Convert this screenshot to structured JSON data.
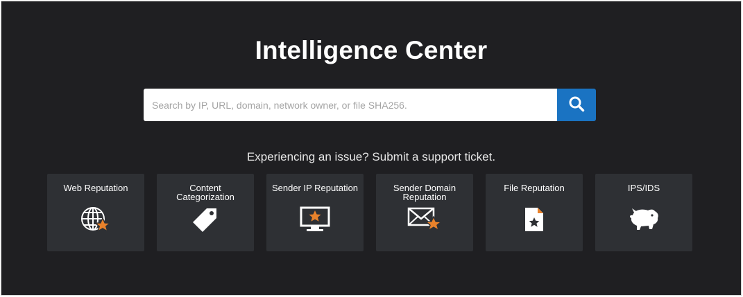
{
  "header": {
    "title": "Intelligence Center"
  },
  "search": {
    "placeholder": "Search by IP, URL, domain, network owner, or file SHA256."
  },
  "support": {
    "text": "Experiencing an issue? Submit a support ticket."
  },
  "tiles": [
    {
      "label": "Web Reputation",
      "icon": "globe-star-icon"
    },
    {
      "label": "Content Categorization",
      "icon": "tag-icon"
    },
    {
      "label": "Sender IP Reputation",
      "icon": "monitor-star-icon"
    },
    {
      "label": "Sender Domain Reputation",
      "icon": "envelope-star-icon"
    },
    {
      "label": "File Reputation",
      "icon": "file-star-icon"
    },
    {
      "label": "IPS/IDS",
      "icon": "pig-icon"
    }
  ],
  "colors": {
    "background": "#1f1f22",
    "tile": "#2e3034",
    "search_button": "#1a73c2",
    "accent_star": "#e9822b"
  }
}
